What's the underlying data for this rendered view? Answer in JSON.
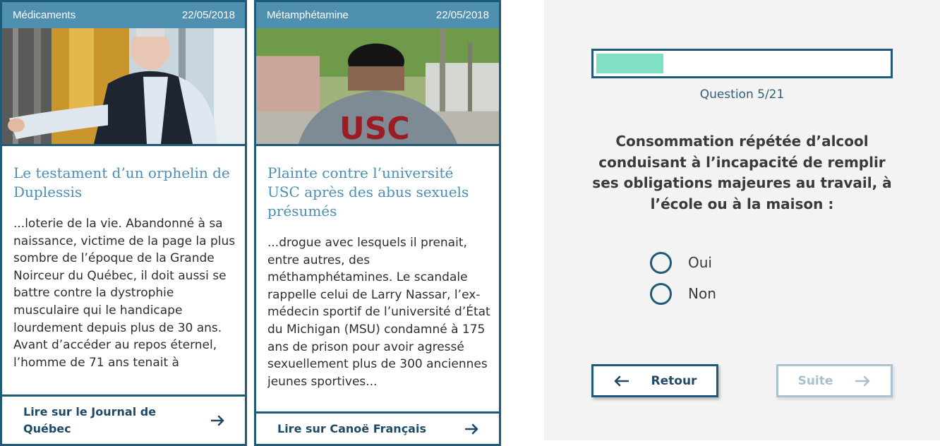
{
  "cards": [
    {
      "category": "Médicaments",
      "date": "22/05/2018",
      "image_icon": "elderly-man-photo",
      "title": "Le testament d’un orphelin de Duplessis",
      "excerpt": "...loterie de la vie. Abandonné à sa naissance, victime de la page la plus sombre de l’époque de la Grande Noirceur du Québec, il doit aussi se battre contre la dystrophie musculaire qui le handicape lourdement depuis plus de 30 ans. Avant d’accéder au repos éternel, l’homme de 71 ans tenait à",
      "link_label": "Lire sur le Journal de Québec",
      "link_icon": "arrow-right-icon"
    },
    {
      "category": "Métamphétamine",
      "date": "22/05/2018",
      "image_icon": "usc-jacket-photo",
      "title": "Plainte contre l’université USC après des abus sexuels présumés",
      "excerpt": "...drogue avec lesquels il prenait, entre autres, des méthamphétamines. Le scandale rappelle celui de Larry Nassar, l’ex-médecin sportif de l’université d’État du Michigan (MSU) condamné à 175 ans de prison pour avoir agressé sexuellement plus de 300 anciennes jeunes sportives...",
      "link_label": "Lire sur Canoë Français",
      "link_icon": "arrow-right-icon"
    }
  ],
  "quiz": {
    "progress": 0.23,
    "question_counter": "Question 5/21",
    "question": "Consommation répétée d’alcool conduisant à l’incapacité de remplir ses obligations majeures au travail, à l’école ou à la maison :",
    "options": [
      "Oui",
      "Non"
    ],
    "back_label": "Retour",
    "next_label": "Suite",
    "colors": {
      "accent": "#1f5a78",
      "progress_fill": "#7fe0c6",
      "disabled": "#a9bfcc"
    }
  }
}
